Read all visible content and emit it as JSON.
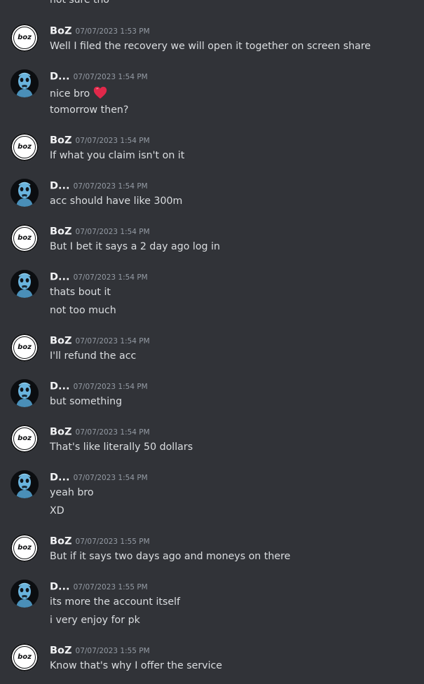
{
  "partial_top_line": "not sure tho",
  "users": {
    "boz": {
      "name": "BoZ",
      "avatar_text": "boz",
      "avatar_icon": "boz-logo-avatar"
    },
    "d": {
      "name": "D...",
      "avatar_icon": "skull-figure-avatar"
    }
  },
  "emoji": {
    "heart": "red-heart-emoji"
  },
  "messages": [
    {
      "author": "BoZ",
      "timestamp": "07/07/2023 1:53 PM",
      "lines": [
        "Well I filed the recovery we will open it together on screen share"
      ]
    },
    {
      "author": "D...",
      "timestamp": "07/07/2023 1:54 PM",
      "lines": [
        "nice bro",
        "tomorrow then?"
      ]
    },
    {
      "author": "BoZ",
      "timestamp": "07/07/2023 1:54 PM",
      "lines": [
        "If what you claim isn't on it"
      ]
    },
    {
      "author": "D...",
      "timestamp": "07/07/2023 1:54 PM",
      "lines": [
        "acc should have like 300m"
      ]
    },
    {
      "author": "BoZ",
      "timestamp": "07/07/2023 1:54 PM",
      "lines": [
        "But I bet it says a 2 day ago log in"
      ]
    },
    {
      "author": "D...",
      "timestamp": "07/07/2023 1:54 PM",
      "lines": [
        "thats bout it",
        "not too much"
      ]
    },
    {
      "author": "BoZ",
      "timestamp": "07/07/2023 1:54 PM",
      "lines": [
        "I'll refund the acc"
      ]
    },
    {
      "author": "D...",
      "timestamp": "07/07/2023 1:54 PM",
      "lines": [
        "but something"
      ]
    },
    {
      "author": "BoZ",
      "timestamp": "07/07/2023 1:54 PM",
      "lines": [
        "That's like literally 50 dollars"
      ]
    },
    {
      "author": "D...",
      "timestamp": "07/07/2023 1:54 PM",
      "lines": [
        "yeah bro",
        "XD"
      ]
    },
    {
      "author": "BoZ",
      "timestamp": "07/07/2023 1:55 PM",
      "lines": [
        "But if it says two days ago and moneys on there"
      ]
    },
    {
      "author": "D...",
      "timestamp": "07/07/2023 1:55 PM",
      "lines": [
        "its more the account itself",
        "i very enjoy for pk"
      ]
    },
    {
      "author": "BoZ",
      "timestamp": "07/07/2023 1:55 PM",
      "lines": [
        "Know that's why I offer the service"
      ]
    }
  ],
  "colors": {
    "background": "#313338",
    "author": "#f2f3f5",
    "timestamp": "#949ba4",
    "text": "#dbdee1",
    "heart": "#e0284a"
  }
}
